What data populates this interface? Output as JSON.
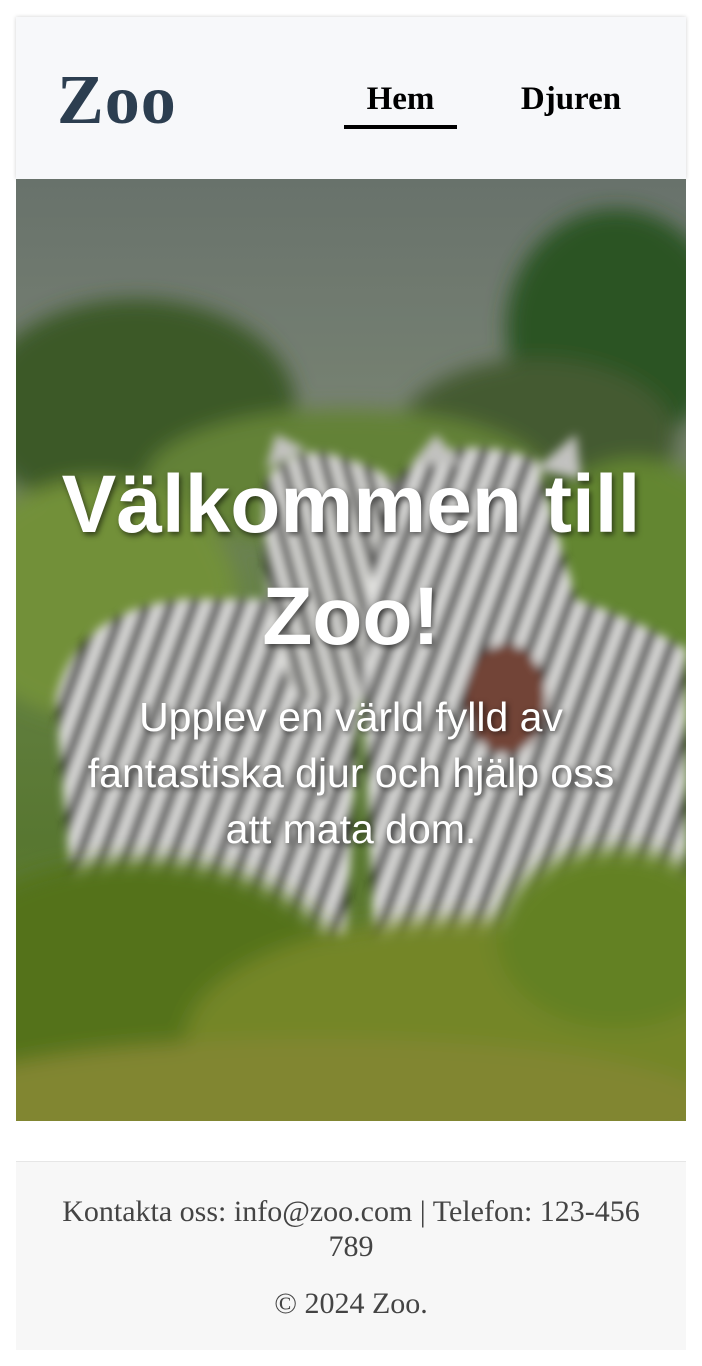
{
  "header": {
    "logo": "Zoo",
    "nav": [
      {
        "label": "Hem",
        "active": true
      },
      {
        "label": "Djuren",
        "active": false
      }
    ]
  },
  "hero": {
    "title": "Välkommen till Zoo!",
    "subtitle": "Upplev en värld fylld av fantastiska djur och hjälp oss att mata dom.",
    "image": "zebras-photo"
  },
  "footer": {
    "contact": "Kontakta oss: info@zoo.com | Telefon: 123-456 789",
    "copyright": "© 2024 Zoo."
  },
  "colors": {
    "logo": "#2c3e50",
    "header_bg": "#f7f8fa",
    "footer_bg": "#f7f7f7",
    "footer_text": "#444444",
    "hero_text": "#ffffff"
  }
}
